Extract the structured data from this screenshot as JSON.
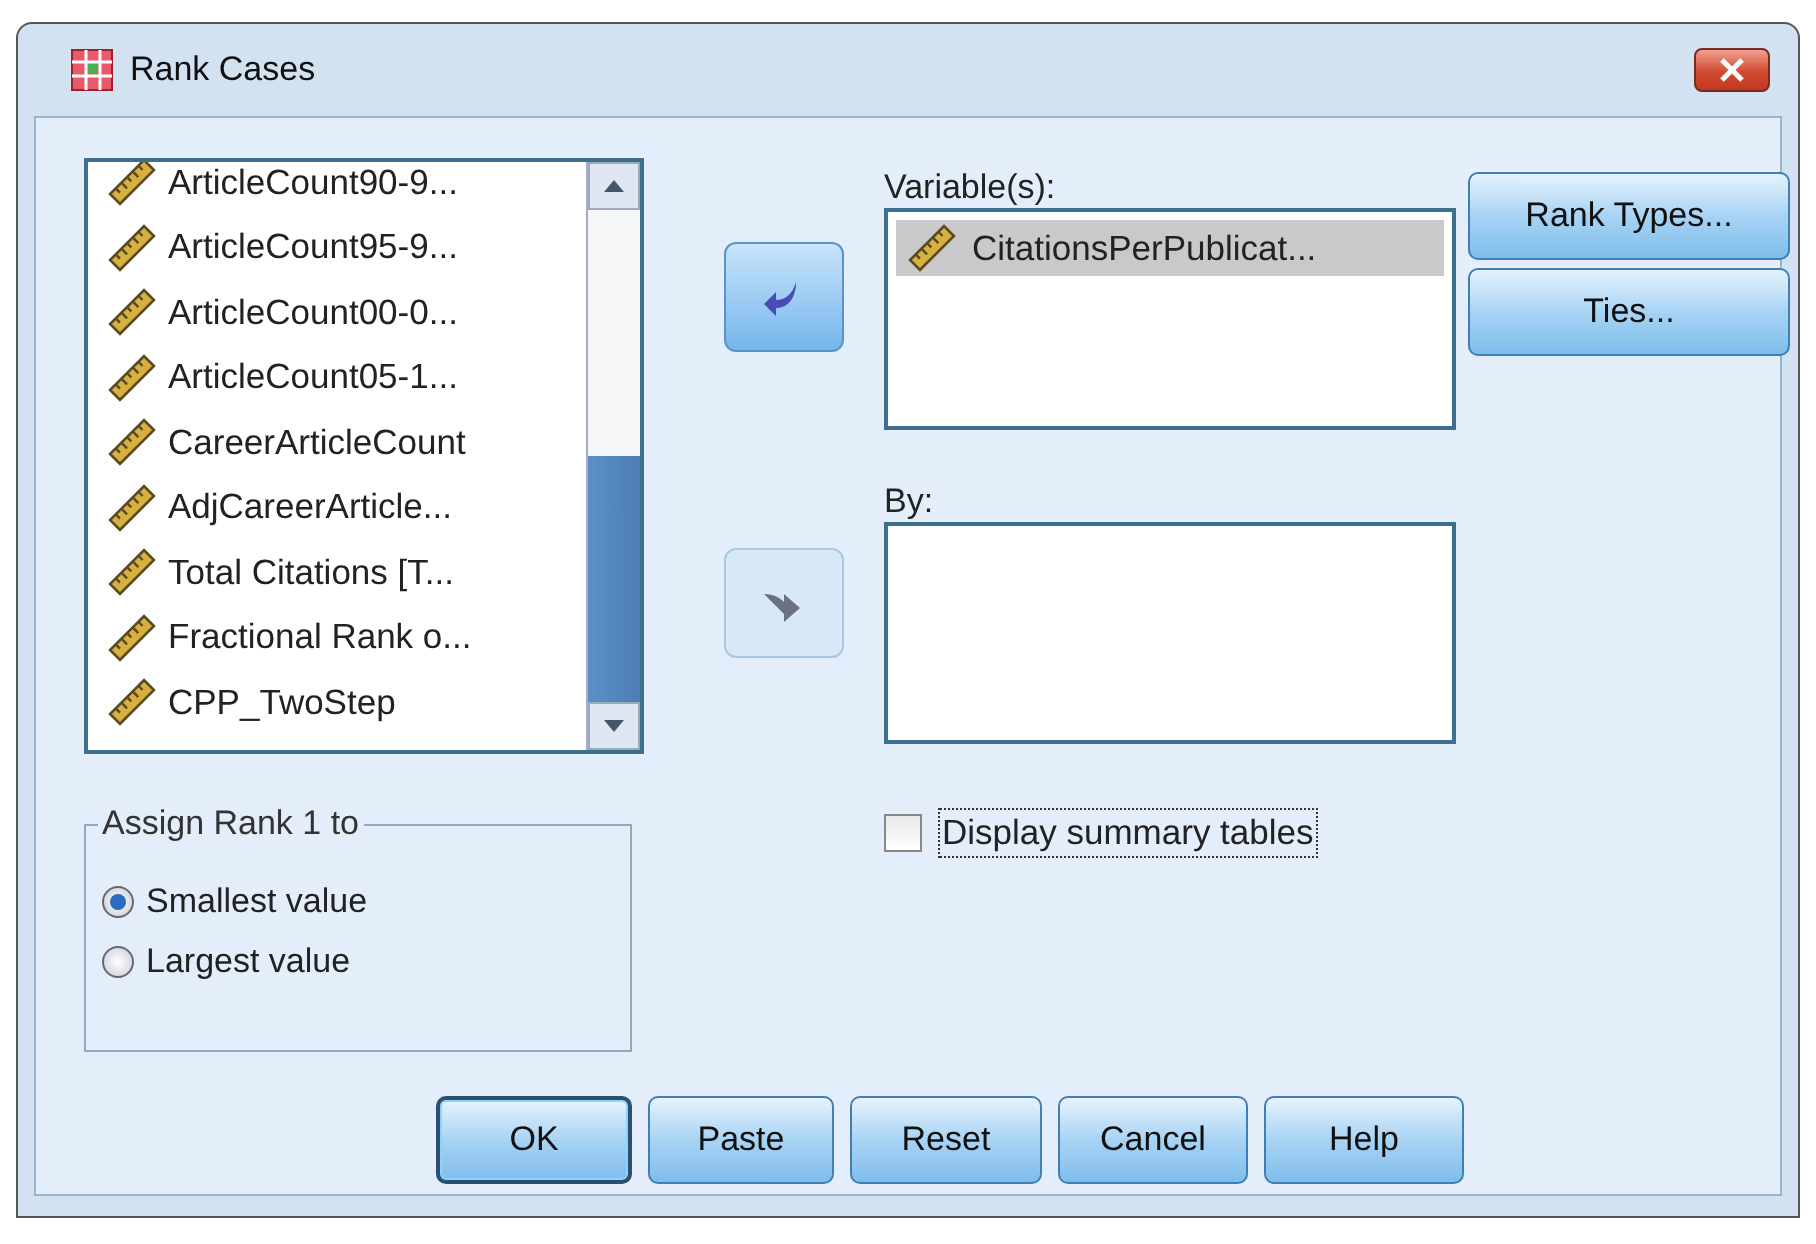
{
  "window": {
    "title": "Rank Cases"
  },
  "source_list": {
    "items": [
      {
        "label": "ArticleCount90-9..."
      },
      {
        "label": "ArticleCount95-9..."
      },
      {
        "label": "ArticleCount00-0..."
      },
      {
        "label": "ArticleCount05-1..."
      },
      {
        "label": "CareerArticleCount"
      },
      {
        "label": "AdjCareerArticle..."
      },
      {
        "label": "Total Citations [T..."
      },
      {
        "label": "Fractional Rank o..."
      },
      {
        "label": "CPP_TwoStep"
      }
    ]
  },
  "move_buttons": [
    {
      "kind": "left",
      "disabled": false
    },
    {
      "kind": "right",
      "disabled": true
    }
  ],
  "variables": {
    "label": "Variable(s):",
    "items": [
      {
        "label": "CitationsPerPublicat...",
        "selected": true
      }
    ]
  },
  "by": {
    "label": "By:"
  },
  "side_buttons": [
    {
      "label": "Rank Types..."
    },
    {
      "label": "Ties..."
    }
  ],
  "summary_checkbox": {
    "label": "Display summary tables",
    "checked": false,
    "focused": true
  },
  "assign_rank": {
    "title": "Assign Rank 1 to",
    "options": [
      {
        "label": "Smallest value",
        "selected": true
      },
      {
        "label": "Largest value",
        "selected": false
      }
    ]
  },
  "buttons": [
    {
      "label": "OK",
      "default": true
    },
    {
      "label": "Paste",
      "default": false
    },
    {
      "label": "Reset",
      "default": false
    },
    {
      "label": "Cancel",
      "default": false
    },
    {
      "label": "Help",
      "default": false
    }
  ]
}
